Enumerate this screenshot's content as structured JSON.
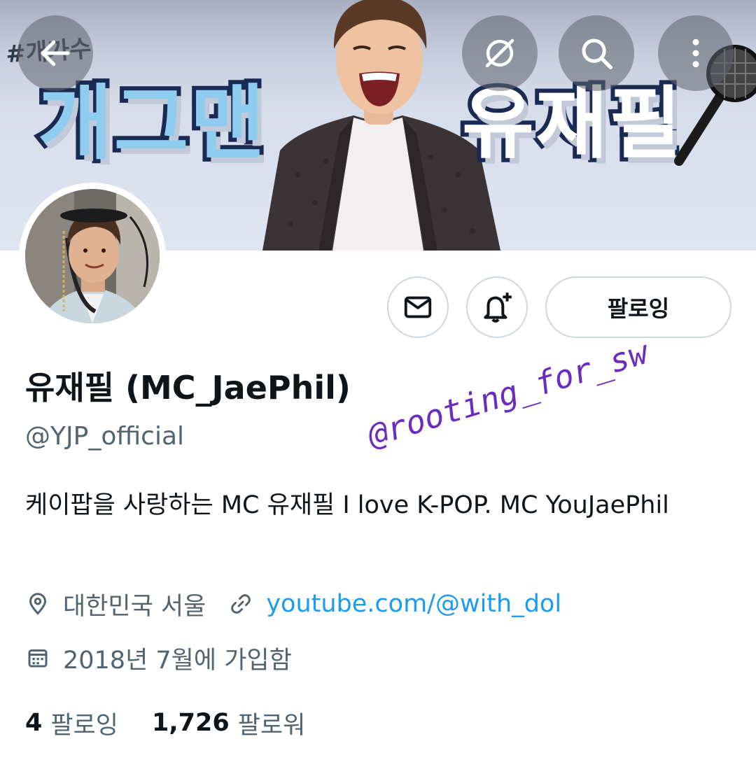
{
  "banner": {
    "tag": "#개가수",
    "left_title": "개그맨",
    "right_title": "유재필"
  },
  "nav": {
    "back_icon": "arrow-left-icon",
    "hide_icon": "eye-slash-icon",
    "search_icon": "search-icon",
    "more_icon": "more-vertical-icon"
  },
  "profile": {
    "display_name": "유재필 (MC_JaePhil)",
    "handle": "@YJP_official",
    "bio": "케이팝을 사랑하는 MC 유재필 I love K-POP. MC YouJaePhil",
    "location": "대한민국 서울",
    "link": "youtube.com/@with_dol",
    "joined": "2018년 7월에 가입함"
  },
  "actions": {
    "message_icon": "mail-icon",
    "notify_icon": "bell-plus-icon",
    "follow_label": "팔로잉"
  },
  "stats": {
    "following_count": "4",
    "following_label": "팔로잉",
    "followers_count": "1,726",
    "followers_label": "팔로워"
  },
  "watermark": "@rooting_for_sw",
  "colors": {
    "accent_link": "#1d9bf0",
    "secondary_text": "#536471",
    "primary_text": "#0f1419",
    "watermark": "#6a2bbf"
  }
}
